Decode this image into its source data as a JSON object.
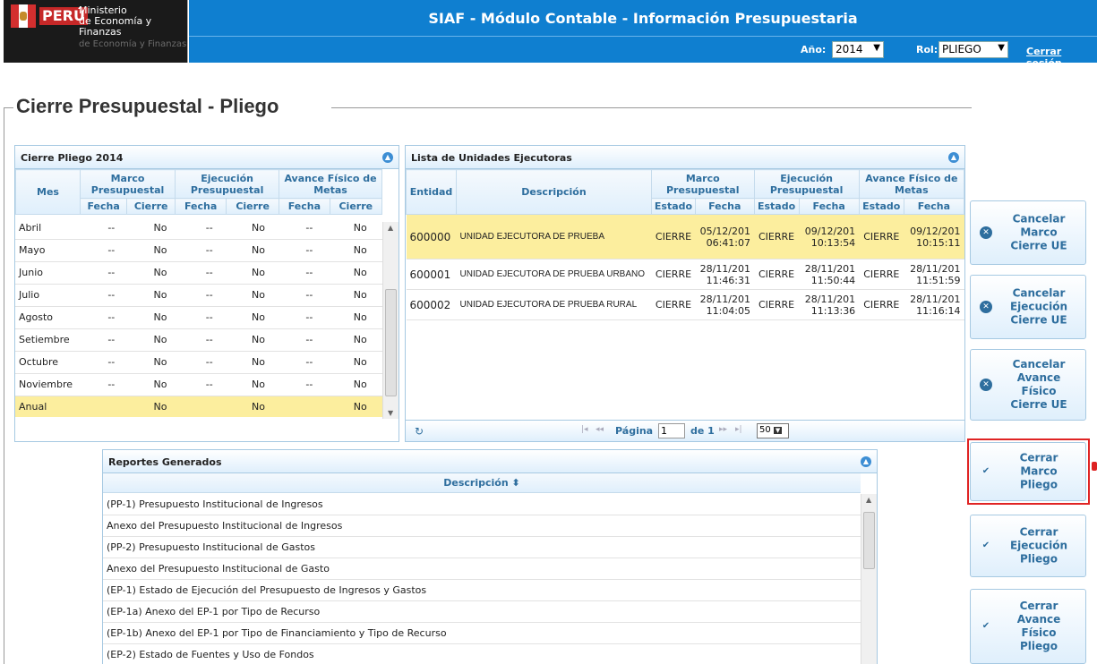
{
  "header": {
    "logo_peru": "PERÚ",
    "ministry_line1": "Ministerio",
    "ministry_line2": "de Economía y Finanzas",
    "ministry_sub": "de Economía y Finanzas",
    "title": "SIAF - Módulo Contable - Información Presupuestaria",
    "year_label": "Año:",
    "year_value": "2014",
    "role_label": "Rol:",
    "role_value": "PLIEGO",
    "logout": "Cerrar sesión"
  },
  "page_title": "Cierre Presupuestal - Pliego",
  "cierre_panel": {
    "title": "Cierre Pliego 2014",
    "col_mes": "Mes",
    "groups": [
      "Marco Presupuestal",
      "Ejecución Presupuestal",
      "Avance Físico de Metas"
    ],
    "sub_fecha": "Fecha",
    "sub_cierre": "Cierre",
    "rows": [
      {
        "mes": "Abril",
        "vals": [
          "--",
          "No",
          "--",
          "No",
          "--",
          "No"
        ]
      },
      {
        "mes": "Mayo",
        "vals": [
          "--",
          "No",
          "--",
          "No",
          "--",
          "No"
        ]
      },
      {
        "mes": "Junio",
        "vals": [
          "--",
          "No",
          "--",
          "No",
          "--",
          "No"
        ]
      },
      {
        "mes": "Julio",
        "vals": [
          "--",
          "No",
          "--",
          "No",
          "--",
          "No"
        ]
      },
      {
        "mes": "Agosto",
        "vals": [
          "--",
          "No",
          "--",
          "No",
          "--",
          "No"
        ]
      },
      {
        "mes": "Setiembre",
        "vals": [
          "--",
          "No",
          "--",
          "No",
          "--",
          "No"
        ]
      },
      {
        "mes": "Octubre",
        "vals": [
          "--",
          "No",
          "--",
          "No",
          "--",
          "No"
        ]
      },
      {
        "mes": "Noviembre",
        "vals": [
          "--",
          "No",
          "--",
          "No",
          "--",
          "No"
        ]
      },
      {
        "mes": "Anual",
        "vals": [
          "",
          "No",
          "",
          "No",
          "",
          "No"
        ]
      }
    ]
  },
  "ue_panel": {
    "title": "Lista de Unidades Ejecutoras",
    "col_entidad": "Entidad",
    "col_desc": "Descripción",
    "groups": [
      "Marco Presupuestal",
      "Ejecución Presupuestal",
      "Avance Físico de Metas"
    ],
    "sub_estado": "Estado",
    "sub_fecha": "Fecha",
    "rows": [
      {
        "entidad": "600000",
        "desc": "UNIDAD EJECUTORA DE PRUEBA",
        "e1": "CIERRE",
        "f1a": "05/12/201",
        "f1b": "06:41:07",
        "e2": "CIERRE",
        "f2a": "09/12/201",
        "f2b": "10:13:54",
        "e3": "CIERRE",
        "f3a": "09/12/201",
        "f3b": "10:15:11"
      },
      {
        "entidad": "600001",
        "desc": "UNIDAD EJECUTORA DE PRUEBA URBANO",
        "e1": "CIERRE",
        "f1a": "28/11/201",
        "f1b": "11:46:31",
        "e2": "CIERRE",
        "f2a": "28/11/201",
        "f2b": "11:50:44",
        "e3": "CIERRE",
        "f3a": "28/11/201",
        "f3b": "11:51:59"
      },
      {
        "entidad": "600002",
        "desc": "UNIDAD EJECUTORA DE PRUEBA RURAL",
        "e1": "CIERRE",
        "f1a": "28/11/201",
        "f1b": "11:04:05",
        "e2": "CIERRE",
        "f2a": "28/11/201",
        "f2b": "11:13:36",
        "e3": "CIERRE",
        "f3a": "28/11/201",
        "f3b": "11:16:14"
      }
    ],
    "pager": {
      "page_label": "Página",
      "page_value": "1",
      "of_label": "de 1",
      "page_size": "50"
    }
  },
  "reports_panel": {
    "title": "Reportes Generados",
    "col_desc": "Descripción",
    "rows": [
      "(PP-1) Presupuesto Institucional de Ingresos",
      "Anexo del Presupuesto Institucional de Ingresos",
      "(PP-2) Presupuesto Institucional de Gastos",
      "Anexo del Presupuesto Institucional de Gasto",
      "(EP-1) Estado de Ejecución del Presupuesto de Ingresos y Gastos",
      "(EP-1a) Anexo del EP-1 por Tipo de Recurso",
      "(EP-1b) Anexo del EP-1 por Tipo de Financiamiento y Tipo de Recurso",
      "(EP-2) Estado de Fuentes y Uso de Fondos"
    ]
  },
  "buttons": {
    "cancel_marco": "Cancelar\nMarco\nCierre UE",
    "cancel_ejec": "Cancelar\nEjecución\nCierre UE",
    "cancel_avance": "Cancelar\nAvance\nFísico\nCierre UE",
    "close_marco": "Cerrar\nMarco\nPliego",
    "close_ejec": "Cerrar\nEjecución\nPliego",
    "close_avance": "Cerrar\nAvance\nFísico\nPliego"
  }
}
